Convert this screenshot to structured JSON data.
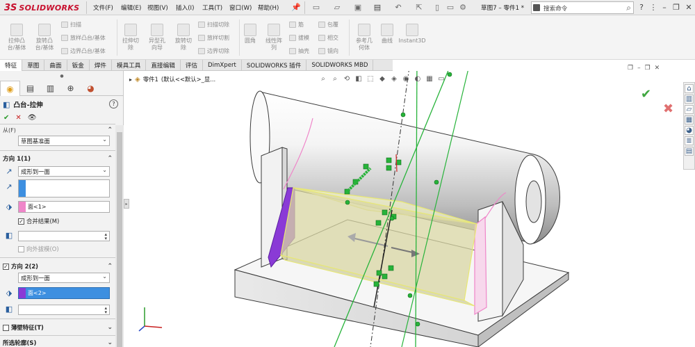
{
  "app": {
    "logo_ds": "3S",
    "logo_text": "SOLIDWORKS",
    "doc_title": "草图7 – 零件1 *"
  },
  "menu": {
    "items": [
      "文件(F)",
      "编辑(E)",
      "视图(V)",
      "插入(I)",
      "工具(T)",
      "窗口(W)",
      "帮助(H)"
    ]
  },
  "search": {
    "placeholder": "搜索命令"
  },
  "ribbon": {
    "extrude_boss": "拉伸凸\n台/基体",
    "revolve_boss": "旋转凸\n台/基体",
    "sweep": "扫描",
    "loft": "放样凸台/基体",
    "boundary": "边界凸台/基体",
    "extrude_cut": "拉伸切\n除",
    "hole_wizard": "异型孔\n向导",
    "revolve_cut": "旋转切\n除",
    "swept_cut": "扫描切除",
    "lofted_cut": "放样切割",
    "boundary_cut": "边界切除",
    "fillet": "圆角",
    "linear_pattern": "线性阵\n列",
    "rib": "筋",
    "draft": "拔模",
    "shell": "抽壳",
    "wrap": "包覆",
    "intersect": "相交",
    "mirror": "镜向",
    "ref_geometry": "参考几\n何体",
    "curves": "曲线",
    "instant3d": "Instant3D"
  },
  "tabs": [
    "特征",
    "草图",
    "曲面",
    "钣金",
    "焊件",
    "模具工具",
    "直接编辑",
    "评估",
    "DimXpert",
    "SOLIDWORKS 插件",
    "SOLIDWORKS MBD"
  ],
  "tree": {
    "part_name": "零件1",
    "config": "(默认<<默认>_显..."
  },
  "feature": {
    "title": "凸台-拉伸",
    "from_label": "从(F)",
    "from_value": "草图基准面",
    "dir1": {
      "label": "方向 1(1)",
      "end_condition": "成形到一面",
      "face": "面<1>",
      "merge": "合并结果(M)",
      "draft_outward": "向外拔模(O)"
    },
    "dir2": {
      "label": "方向 2(2)",
      "end_condition": "成形到一面",
      "face": "面<2>"
    },
    "thin_feature": "薄壁特征(T)",
    "selected_contours": "所选轮廓(S)"
  },
  "colors": {
    "accent_blue": "#3d8fe0",
    "pink_face": "#ef86c9",
    "purple_face": "#8a3ad6",
    "sketch_green": "#27b33a",
    "preview_yellow": "#e8e873"
  }
}
